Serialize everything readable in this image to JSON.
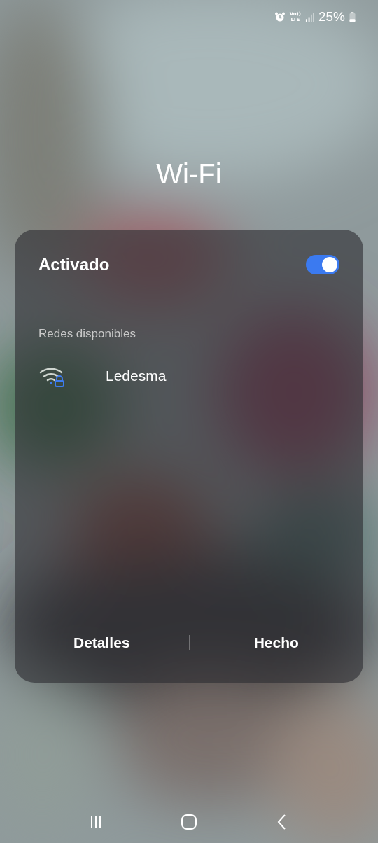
{
  "status_bar": {
    "volte_top": "Vo))",
    "volte_bottom": "LTE",
    "battery": "25%"
  },
  "title": "Wi-Fi",
  "panel": {
    "master": {
      "label": "Activado",
      "on": true
    },
    "section_label": "Redes disponibles",
    "networks": [
      {
        "name": "Ledesma",
        "secured": true
      }
    ],
    "buttons": [
      {
        "label": "Detalles"
      },
      {
        "label": "Hecho"
      }
    ]
  }
}
